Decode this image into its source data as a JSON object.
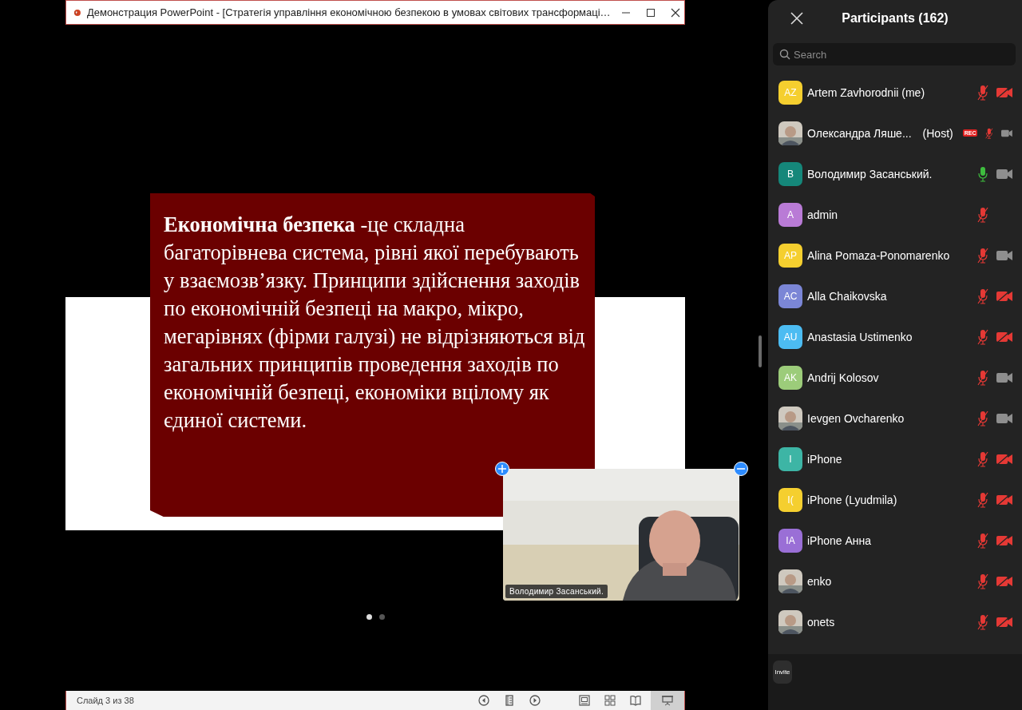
{
  "presentation_window": {
    "title": "Демонстрация PowerPoint - [Стратегія управління економічною безпекою в умовах світових трансформаці…",
    "slide": {
      "text": "**Економічна безпека** -це складна багаторівнева система,  рівні якої перебувають у взаємозв’язку. Принципи здійснення заходів  по економічній безпеці на макро, мікро, мегарівнях (фірми галузі) не відрізняються від загальних принципів проведення заходів по  економічній безпеці, економіки вцілому як єдиної системи."
    },
    "pager": [
      {
        "selected": true
      },
      {
        "selected": false
      }
    ],
    "status_bar": {
      "slide_counter": "Слайд 3 из 38",
      "views": [
        {
          "kind": "previous",
          "selected": false
        },
        {
          "kind": "slides",
          "selected": false
        },
        {
          "kind": "next",
          "selected": false
        },
        {
          "kind": "normal",
          "selected": false
        },
        {
          "kind": "sorter",
          "selected": false
        },
        {
          "kind": "reading",
          "selected": false
        },
        {
          "kind": "presenter",
          "selected": true
        }
      ]
    }
  },
  "video_tile": {
    "kind": "picture",
    "name": "Володимир Засанський."
  },
  "participants_panel": {
    "title": "Participants (162)",
    "search": {
      "placeholder": "Search"
    },
    "participants": [
      {
        "avatar": {
          "kind": "initials",
          "text": "AZ",
          "color": "#f5cf2f"
        },
        "name": "Artem Zavhorodnii (me)",
        "mic_muted": true,
        "video_on": false
      },
      {
        "name": "Олександра Ляше...",
        "role": "(Host)",
        "badge": "REC",
        "mic_muted": true,
        "video_on": true
      },
      {
        "avatar": {
          "kind": "initials",
          "text": "B",
          "color": "#15877a"
        },
        "name": "Володимир Засанський.",
        "mic_muted": false,
        "video_on": true
      },
      {
        "avatar": {
          "kind": "initials",
          "text": "A",
          "color": "#b97bd6"
        },
        "name": "admin",
        "mic_muted": true
      },
      {
        "avatar": {
          "kind": "initials",
          "text": "AP",
          "color": "#f5cf2f"
        },
        "name": "Alina Pomaza-Ponomarenko",
        "mic_muted": true,
        "video_on": true
      },
      {
        "avatar": {
          "kind": "initials",
          "text": "AC",
          "color": "#7b86d6"
        },
        "name": "Alla Chaikovska",
        "mic_muted": true,
        "video_on": false
      },
      {
        "avatar": {
          "kind": "initials",
          "text": "AU",
          "color": "#4cbcf2"
        },
        "name": "Anastasia Ustimenko",
        "mic_muted": true,
        "video_on": false
      },
      {
        "avatar": {
          "kind": "initials",
          "text": "AK",
          "color": "#9ccc7a"
        },
        "name": "Andrij Kolosov",
        "mic_muted": true,
        "video_on": true
      },
      {
        "name": "Ievgen Ovcharenko",
        "mic_muted": true,
        "video_on": true
      },
      {
        "avatar": {
          "kind": "initials",
          "text": "I",
          "color": "#3db5a5"
        },
        "name": "iPhone",
        "mic_muted": true,
        "video_on": false
      },
      {
        "avatar": {
          "kind": "initials",
          "text": "I(",
          "color": "#f5cf2f"
        },
        "name": "iPhone (Lyudmila)",
        "mic_muted": true,
        "video_on": false
      },
      {
        "avatar": {
          "kind": "initials",
          "text": "IA",
          "color": "#9a6fd6"
        },
        "name": "iPhone Анна",
        "mic_muted": true,
        "video_on": false
      },
      {
        "name": "enko",
        "mic_muted": true,
        "video_on": false
      },
      {
        "name": "onets",
        "mic_muted": true,
        "video_on": false
      }
    ],
    "invite_button": "Invite"
  }
}
